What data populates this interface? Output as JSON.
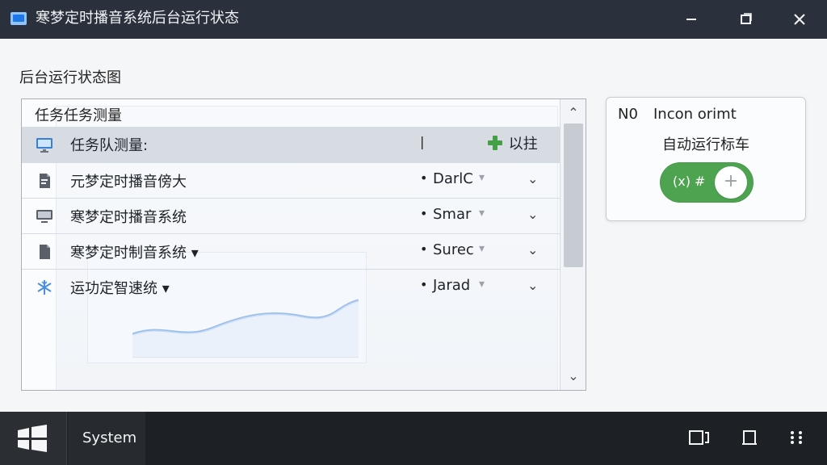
{
  "window": {
    "title": "寒梦定时播音系统后台运行状态",
    "icons": {
      "app": "app-window-icon",
      "minimize": "minimize-icon",
      "maximize": "maximize-icon",
      "close": "close-icon"
    }
  },
  "main": {
    "section_title": "后台运行状态图",
    "panel_header": "任务任务测量",
    "rows": [
      {
        "icon": "monitor-icon",
        "label": "任务队测量:",
        "marker": "|",
        "value": "",
        "extra": "以拄",
        "extra_icon": "green-plus-icon",
        "chevron": "",
        "active": true
      },
      {
        "icon": "document-icon",
        "label": "元梦定时播音傍大",
        "marker": "•",
        "value": "DarlC",
        "value_arrow": "▾",
        "chevron": "⌄",
        "active": false
      },
      {
        "icon": "display-icon",
        "label": "寒梦定时播音系统",
        "marker": "•",
        "value": "Smar",
        "value_arrow": "▾",
        "chevron": "⌄",
        "active": false
      },
      {
        "icon": "file-icon",
        "label": "寒梦定时制音系统 ▾",
        "marker": "•",
        "value": "Surec",
        "value_arrow": "▾",
        "chevron": "⌄",
        "active": false
      },
      {
        "icon": "snowflake-icon",
        "label": "运功定智速统 ▾",
        "marker": "•",
        "value": "Jarad",
        "value_arrow": "▾",
        "chevron": "⌄",
        "active": false
      }
    ],
    "scrollbar": {
      "up": "⌃",
      "down": "⌄"
    }
  },
  "card": {
    "number": "N0",
    "title": "Incon orimt",
    "subtitle": "自动运行标车",
    "toggle_label": "(x) #",
    "toggle_plus": "+",
    "toggle_on": true,
    "toggle_color": "#4da350"
  },
  "taskbar": {
    "system_label": "System",
    "icons": {
      "start": "windows-start-icon",
      "task1": "task-view-icon",
      "task2": "clipboard-icon",
      "task3": "grid-dots-icon"
    }
  }
}
